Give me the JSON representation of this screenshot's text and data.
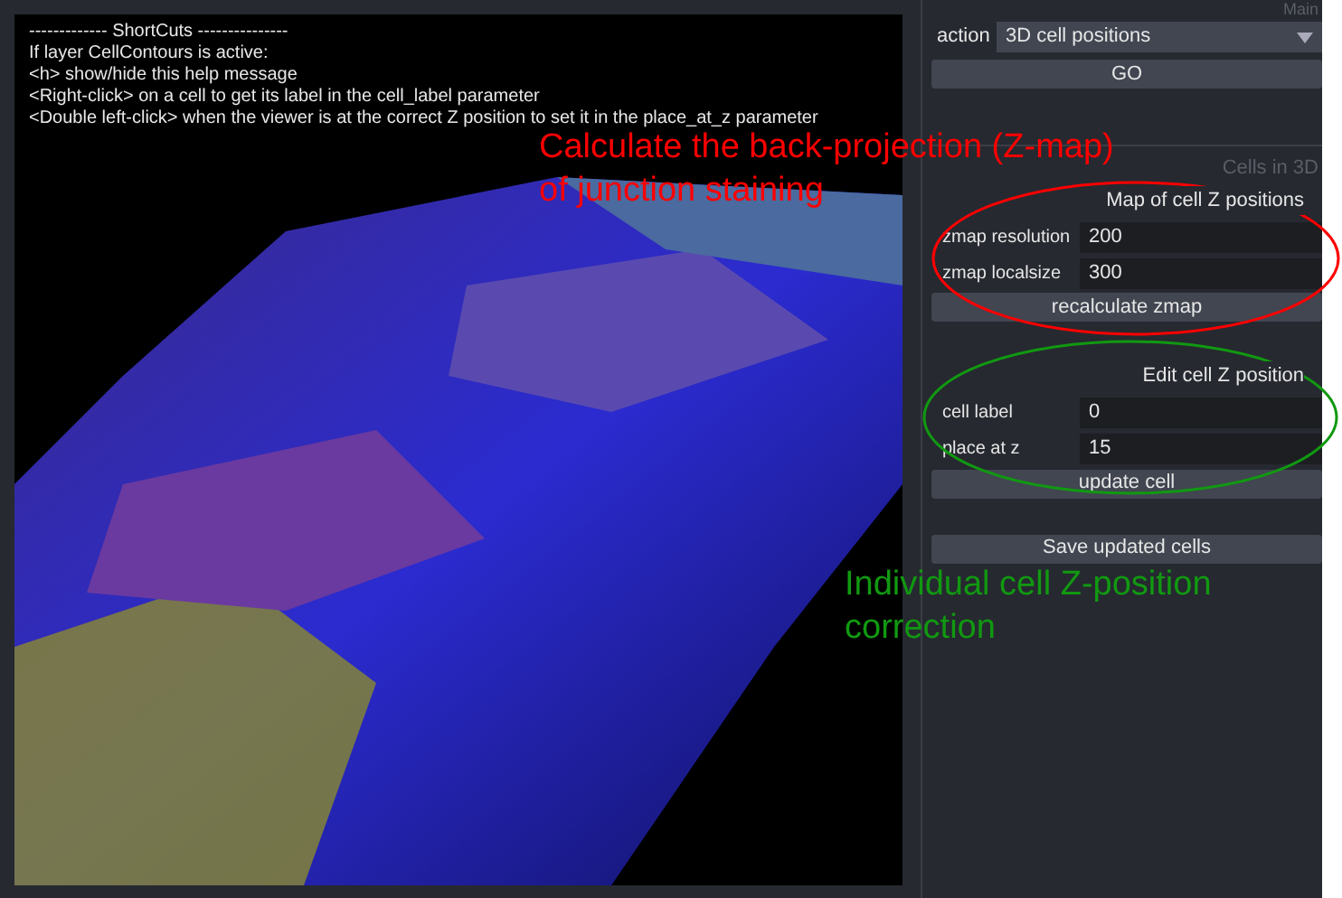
{
  "viewer": {
    "help_lines": [
      "------------- ShortCuts ---------------",
      "If layer CellContours is active:",
      "<h> show/hide this help message",
      "<Right-click> on a cell to get its label in the cell_label parameter",
      "<Double left-click> when the viewer is at the correct Z position to set it in the place_at_z parameter"
    ]
  },
  "panel": {
    "top_header": "Main",
    "action": {
      "label": "action",
      "value": "3D cell positions"
    },
    "go_button": "GO",
    "section_header": "Cells in 3D",
    "groups": [
      {
        "title": "Map of cell Z positions",
        "fields": [
          {
            "label": "zmap resolution",
            "value": "200"
          },
          {
            "label": "zmap localsize",
            "value": "300"
          }
        ],
        "button": "recalculate zmap"
      },
      {
        "title": "Edit cell Z position",
        "fields": [
          {
            "label": "cell label",
            "value": "0"
          },
          {
            "label": "place at z",
            "value": "15"
          }
        ],
        "button": "update cell"
      }
    ],
    "save_button": "Save updated cells"
  },
  "annotations": [
    {
      "lines": [
        "Calculate the back-projection (Z-map)",
        "of junction staining"
      ],
      "color": "#ff0000"
    },
    {
      "lines": [
        "Individual cell Z-position",
        "correction"
      ],
      "color": "#119911"
    }
  ]
}
